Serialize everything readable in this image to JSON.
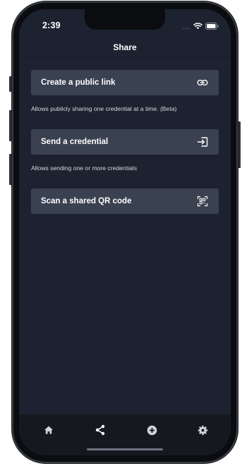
{
  "status_bar": {
    "time": "2:39",
    "signal": "....",
    "icons": [
      "wifi-icon",
      "battery-icon"
    ]
  },
  "header": {
    "title": "Share"
  },
  "actions": [
    {
      "label": "Create a public link",
      "icon": "link-icon",
      "description": "Allows publicly sharing one credential at a time. (Beta)"
    },
    {
      "label": "Send a credential",
      "icon": "send-arrow-icon",
      "description": "Allows sending one or more credentials"
    },
    {
      "label": "Scan a shared QR code",
      "icon": "qr-scan-icon",
      "description": ""
    }
  ],
  "tabbar": {
    "items": [
      "home-icon",
      "share-icon",
      "add-circle-icon",
      "settings-icon"
    ],
    "active": "share-icon"
  },
  "colors": {
    "background": "#1d2230",
    "card": "#3a4150",
    "tabbar": "#15191f",
    "text": "#ffffff",
    "muted_text": "#d6d9e0",
    "inactive_icon": "#d0d4dc"
  }
}
